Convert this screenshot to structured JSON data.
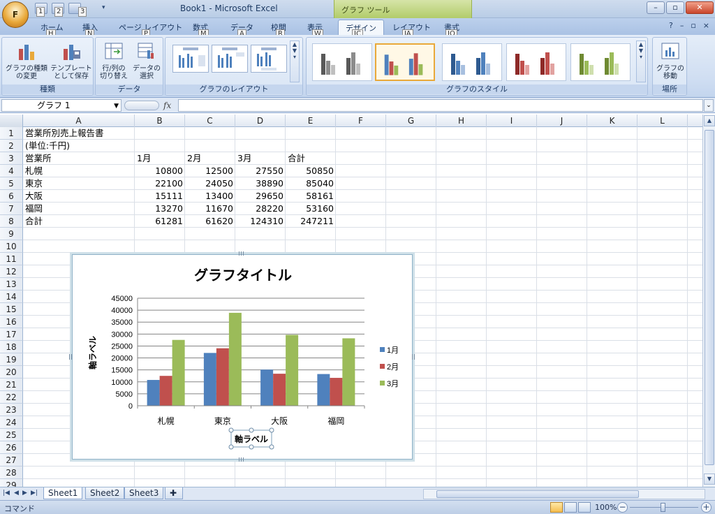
{
  "title_bar": {
    "title": "Book1 - Microsoft Excel",
    "context_tab": "グラフ ツール",
    "office_button_keytip": "F",
    "qat_keytips": [
      "1",
      "2",
      "3"
    ],
    "window_buttons": [
      "–",
      "▫",
      "✕"
    ]
  },
  "tabs": [
    {
      "label": "ホーム",
      "keytip": "H"
    },
    {
      "label": "挿入",
      "keytip": "N"
    },
    {
      "label": "ページ レイアウト",
      "keytip": "P"
    },
    {
      "label": "数式",
      "keytip": "M"
    },
    {
      "label": "データ",
      "keytip": "A"
    },
    {
      "label": "校閲",
      "keytip": "R"
    },
    {
      "label": "表示",
      "keytip": "W"
    },
    {
      "label": "デザイン",
      "keytip": "JC"
    },
    {
      "label": "レイアウト",
      "keytip": "JA"
    },
    {
      "label": "書式",
      "keytip": "JO"
    }
  ],
  "ribbon": {
    "groups": {
      "type": "種類",
      "data": "データ",
      "layout": "グラフのレイアウト",
      "style": "グラフのスタイル",
      "location": "場所"
    },
    "buttons": {
      "change_type_1": "グラフの種類",
      "change_type_2": "の変更",
      "save_template_1": "テンプレート",
      "save_template_2": "として保存",
      "switch_row_col_1": "行/列の",
      "switch_row_col_2": "切り替え",
      "select_data_1": "データの",
      "select_data_2": "選択",
      "move_chart_1": "グラフの",
      "move_chart_2": "移動"
    }
  },
  "formula_bar": {
    "name_box": "グラフ 1",
    "fx": "fx",
    "formula": ""
  },
  "columns": [
    "A",
    "B",
    "C",
    "D",
    "E",
    "F",
    "G",
    "H",
    "I",
    "J",
    "K",
    "L"
  ],
  "rows": [
    "1",
    "2",
    "3",
    "4",
    "5",
    "6",
    "7",
    "8",
    "9",
    "10",
    "11",
    "12",
    "13",
    "14",
    "15",
    "16",
    "17",
    "18",
    "19",
    "20",
    "21",
    "22",
    "23",
    "24",
    "25",
    "26",
    "27",
    "28",
    "29"
  ],
  "cells": {
    "a1": "営業所別売上報告書",
    "a2": "(単位:千円)",
    "header": [
      "営業所",
      "1月",
      "2月",
      "3月",
      "合計"
    ],
    "data": [
      [
        "札幌",
        "10800",
        "12500",
        "27550",
        "50850"
      ],
      [
        "東京",
        "22100",
        "24050",
        "38890",
        "85040"
      ],
      [
        "大阪",
        "15111",
        "13400",
        "29650",
        "58161"
      ],
      [
        "福岡",
        "13270",
        "11670",
        "28220",
        "53160"
      ],
      [
        "合計",
        "61281",
        "61620",
        "124310",
        "247211"
      ]
    ]
  },
  "chart_data": {
    "type": "bar",
    "title": "グラフタイトル",
    "xlabel": "軸ラベル",
    "ylabel": "軸ラベル",
    "categories": [
      "札幌",
      "東京",
      "大阪",
      "福岡"
    ],
    "series": [
      {
        "name": "1月",
        "color": "#4f81bd",
        "values": [
          10800,
          22100,
          15111,
          13270
        ]
      },
      {
        "name": "2月",
        "color": "#c0504d",
        "values": [
          12500,
          24050,
          13400,
          11670
        ]
      },
      {
        "name": "3月",
        "color": "#9bbb59",
        "values": [
          27550,
          38890,
          29650,
          28220
        ]
      }
    ],
    "ylim": [
      0,
      45000
    ],
    "yticks": [
      "0",
      "5000",
      "10000",
      "15000",
      "20000",
      "25000",
      "30000",
      "35000",
      "40000",
      "45000"
    ],
    "grid": true,
    "legend": "right"
  },
  "sheets": [
    "Sheet1",
    "Sheet2",
    "Sheet3"
  ],
  "status_bar": {
    "mode": "コマンド",
    "zoom": "100%"
  }
}
